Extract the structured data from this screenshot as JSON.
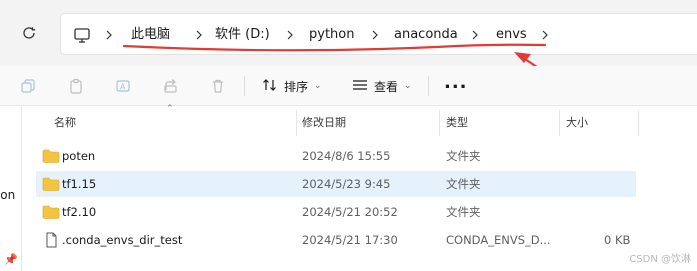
{
  "breadcrumb": {
    "items": [
      "此电脑",
      "软件 (D:)",
      "python",
      "anaconda",
      "envs"
    ]
  },
  "toolbar": {
    "sort_label": "排序",
    "view_label": "查看",
    "more_label": "..."
  },
  "columns": {
    "name": "名称",
    "date": "修改日期",
    "type": "类型",
    "size": "大小"
  },
  "files": [
    {
      "name": "poten",
      "date": "2024/8/6 15:55",
      "type": "文件夹",
      "size": "",
      "icon": "folder-icon",
      "selected": false
    },
    {
      "name": "tf1.15",
      "date": "2024/5/23 9:45",
      "type": "文件夹",
      "size": "",
      "icon": "folder-icon",
      "selected": true
    },
    {
      "name": "tf2.10",
      "date": "2024/5/21 20:52",
      "type": "文件夹",
      "size": "",
      "icon": "folder-icon",
      "selected": false
    },
    {
      "name": ".conda_envs_dir_test",
      "date": "2024/5/21 17:30",
      "type": "CONDA_ENVS_D...",
      "size": "0 KB",
      "icon": "file-icon",
      "selected": false
    }
  ],
  "left_pane": {
    "partial_label": "son"
  },
  "watermark": "CSDN @饮淋",
  "colors": {
    "annotation_red": "#e53935",
    "selection": "#e5f1fb",
    "folder_yellow": "#f5c342"
  }
}
